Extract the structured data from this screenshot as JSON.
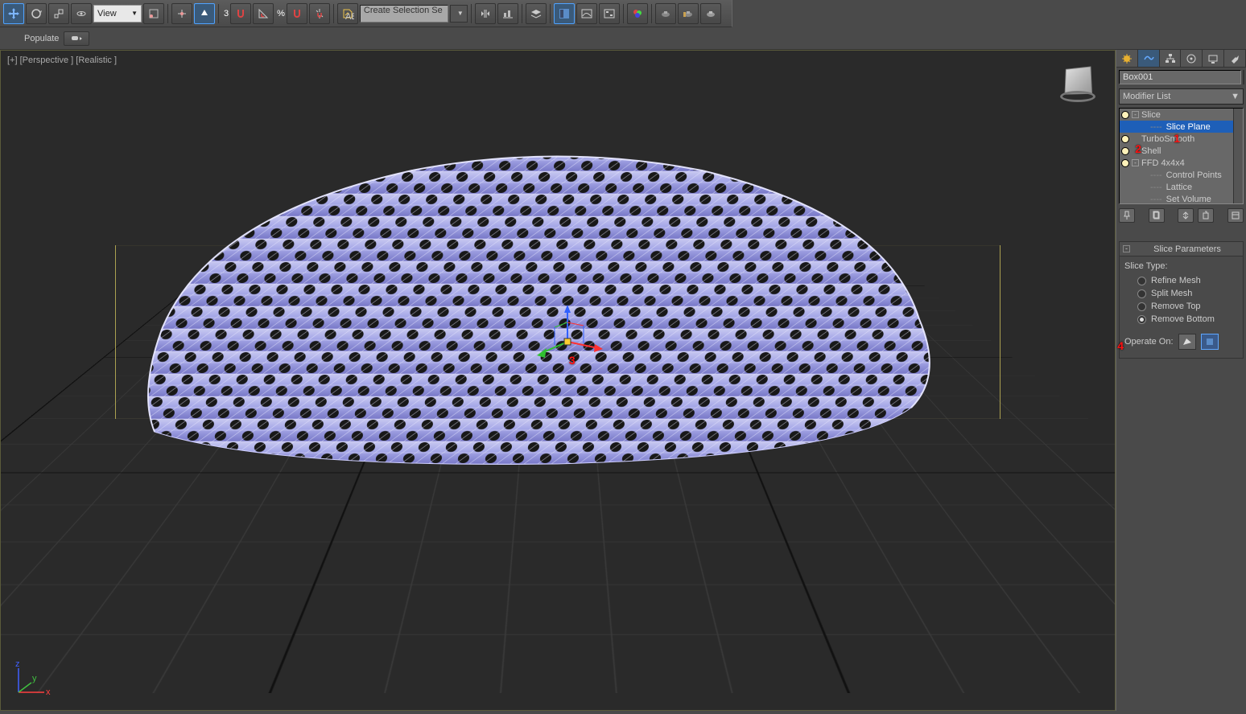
{
  "toolbar": {
    "view_dropdown": "View",
    "snap_number": "3",
    "percent": "%",
    "selection_input": "Create Selection Se"
  },
  "subtoolbar": {
    "populate": "Populate"
  },
  "viewport": {
    "label": "[+] [Perspective ] [Realistic ]"
  },
  "panel": {
    "object_name": "Box001",
    "modifier_list_label": "Modifier List",
    "stack": {
      "slice": "Slice",
      "slice_plane": "Slice Plane",
      "turbosmooth": "TurboSmooth",
      "shell": "Shell",
      "ffd": "FFD 4x4x4",
      "control_points": "Control Points",
      "lattice": "Lattice",
      "set_volume": "Set Volume"
    },
    "rollout": {
      "title": "Slice Parameters",
      "slice_type_label": "Slice Type:",
      "refine_mesh": "Refine Mesh",
      "split_mesh": "Split Mesh",
      "remove_top": "Remove Top",
      "remove_bottom": "Remove Bottom",
      "operate_on": "Operate On:"
    }
  },
  "annotations": {
    "a1": "1",
    "a2": "2",
    "a3": "3",
    "a4": "4"
  }
}
